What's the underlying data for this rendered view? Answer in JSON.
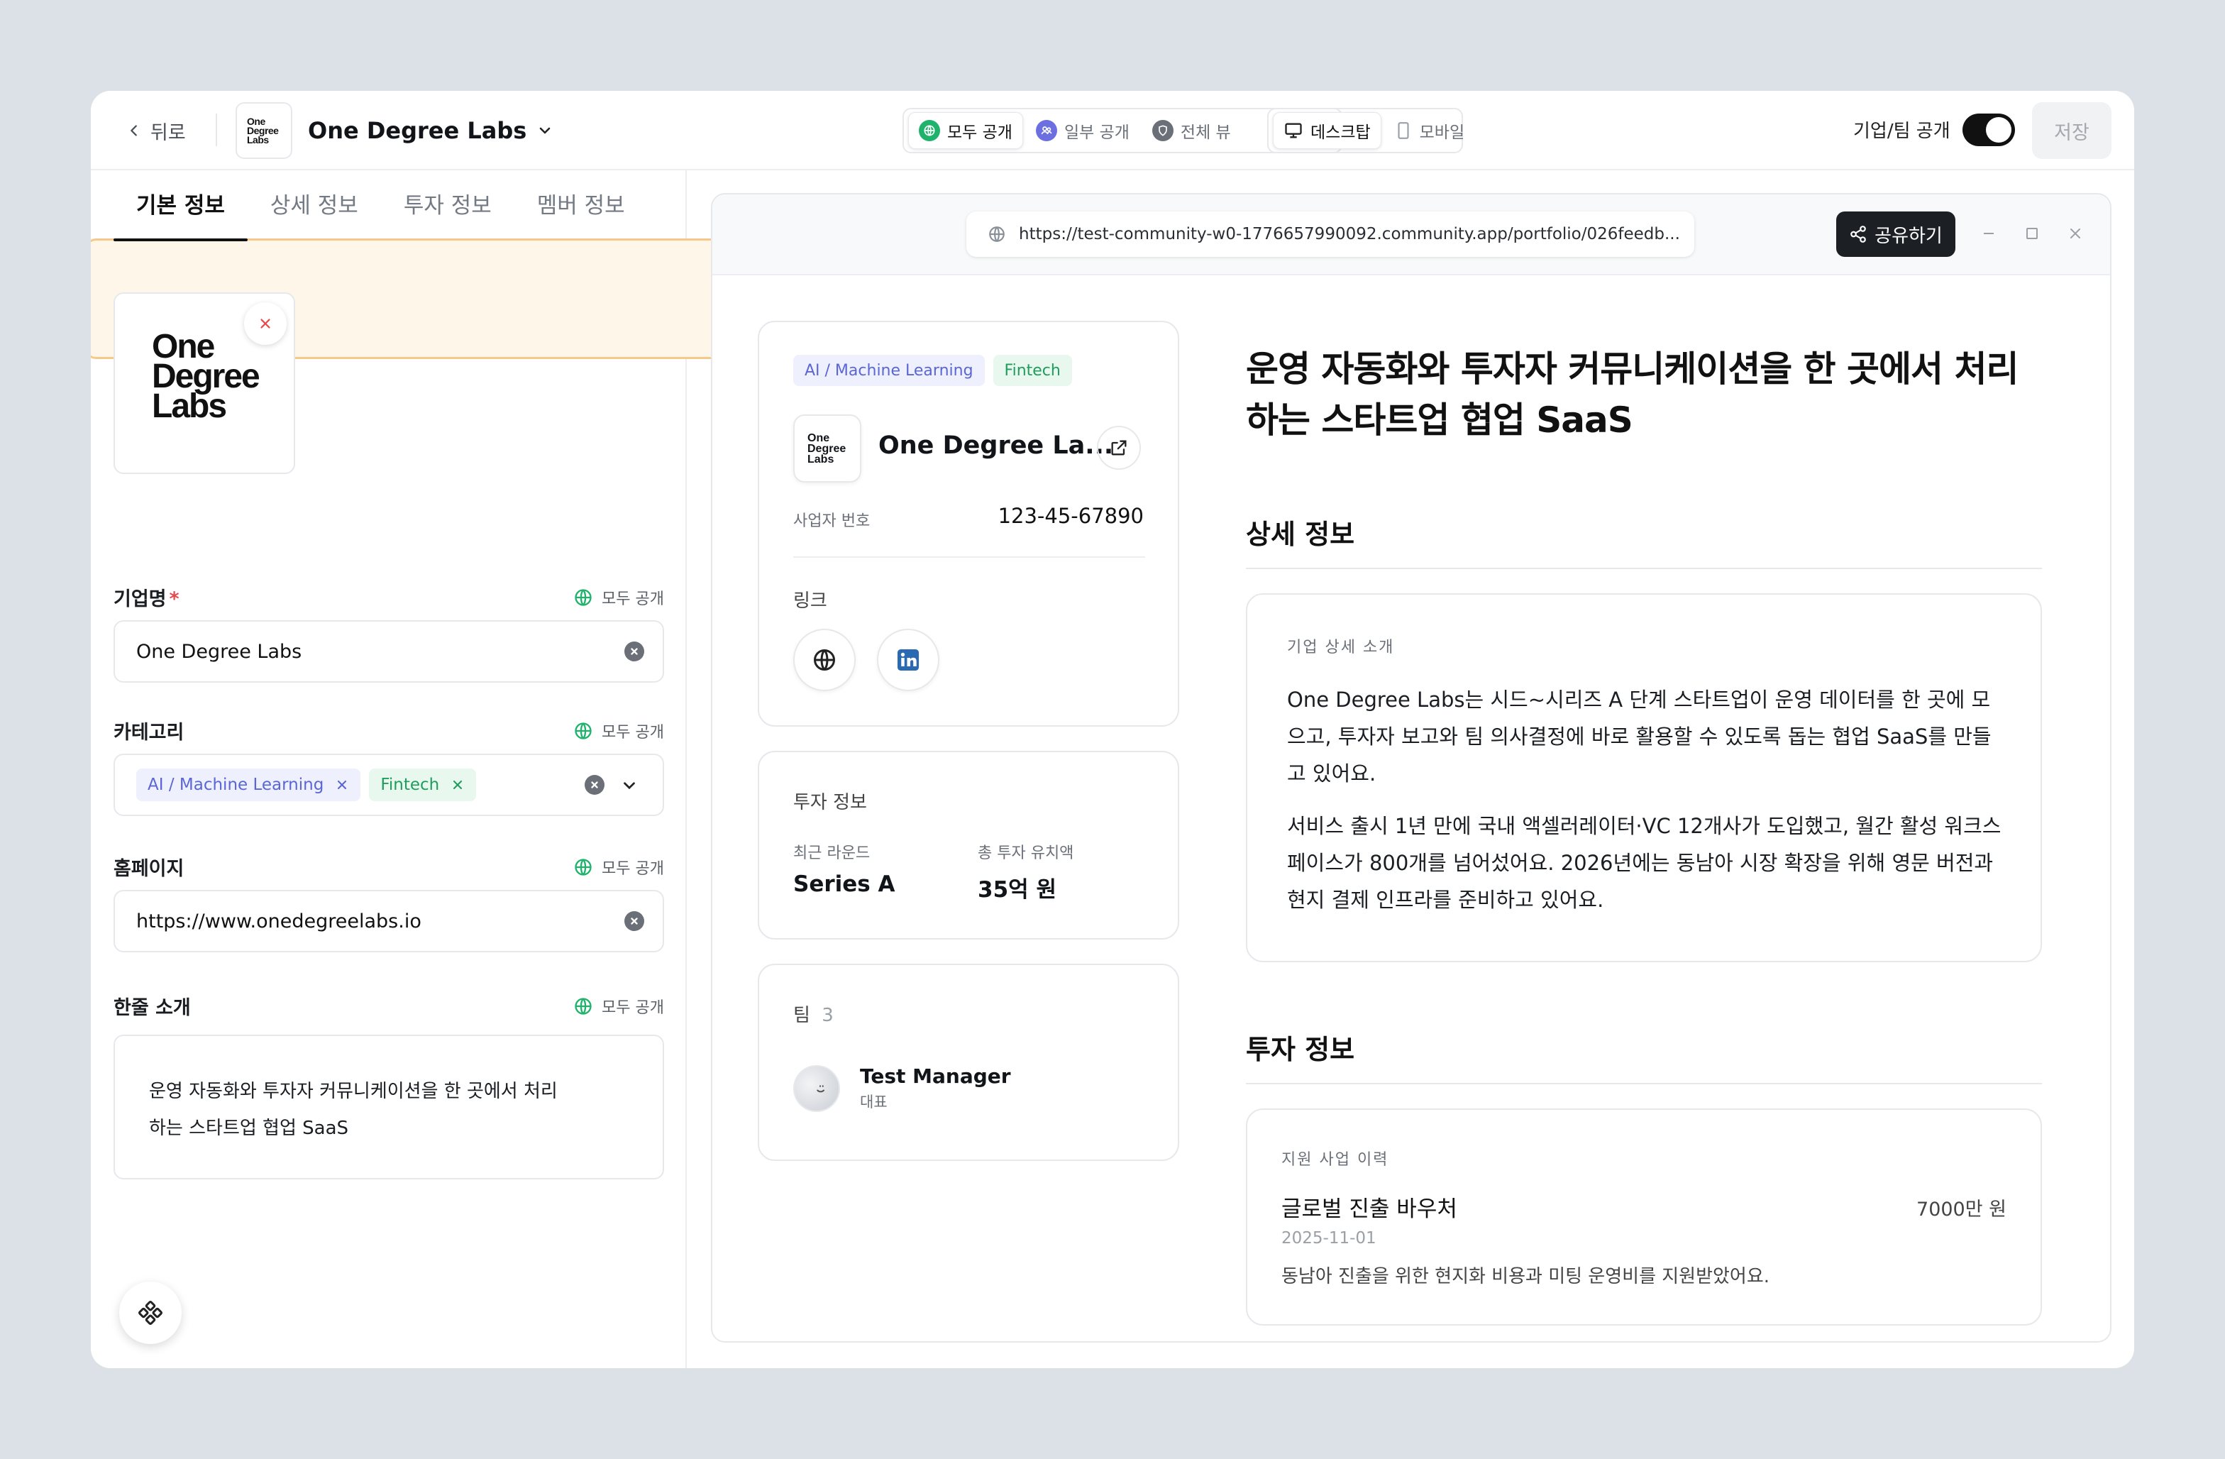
{
  "topbar": {
    "back_label": "뒤로",
    "logo_lines": [
      "One",
      "Degree",
      "Labs"
    ],
    "company_name": "One Degree Labs",
    "visibility_options": [
      {
        "label": "모두 공개",
        "color": "#1fb26b",
        "active": true
      },
      {
        "label": "일부 공개",
        "color": "#6b6fe0",
        "active": false
      },
      {
        "label": "전체 뷰",
        "color": "#6b7078",
        "active": false
      }
    ],
    "device_options": [
      {
        "label": "데스크탑",
        "active": true
      },
      {
        "label": "모바일",
        "active": false
      }
    ],
    "public_toggle_label": "기업/팀 공개",
    "public_toggle_on": true,
    "save_label": "저장"
  },
  "left_panel": {
    "tabs": [
      {
        "label": "기본 정보",
        "active": true
      },
      {
        "label": "상세 정보",
        "active": false
      },
      {
        "label": "투자 정보",
        "active": false
      },
      {
        "label": "멤버 정보",
        "active": false
      }
    ],
    "logo_lines": [
      "One",
      "Degree",
      "Labs"
    ],
    "visibility_label": "모두 공개",
    "fields": {
      "company_name": {
        "label": "기업명",
        "required_mark": "*",
        "value": "One Degree Labs"
      },
      "category": {
        "label": "카테고리",
        "chips": [
          "AI / Machine Learning",
          "Fintech"
        ]
      },
      "homepage": {
        "label": "홈페이지",
        "value": "https://www.onedegreelabs.io"
      },
      "tagline": {
        "label": "한줄 소개",
        "lines": [
          "운영 자동화와 투자자 커뮤니케이션을 한 곳에서 처리",
          "하는 스타트업 협업 SaaS"
        ]
      }
    }
  },
  "preview": {
    "url": "https://test-community-w0-1776657990092.community.app/portfolio/026feedb...",
    "share_label": "공유하기",
    "profile_card": {
      "tags": [
        "AI / Machine Learning",
        "Fintech"
      ],
      "name": "One Degree La...",
      "biz_label": "사업자 번호",
      "biz_number": "123-45-67890",
      "links_label": "링크"
    },
    "invest_card": {
      "title": "투자 정보",
      "round_label": "최근 라운드",
      "round_value": "Series A",
      "total_label": "총 투자 유치액",
      "total_value": "35억 원"
    },
    "team_card": {
      "title": "팀",
      "count": "3",
      "member_name": "Test Manager",
      "member_role": "대표"
    },
    "headline_lines": [
      "운영 자동화와 투자자 커뮤니케이션을 한 곳에서 처리",
      "하는 스타트업 협업 SaaS"
    ],
    "detail": {
      "section_title": "상세 정보",
      "box_label": "기업 상세 소개",
      "paragraph1": "One Degree Labs는 시드~시리즈 A 단계 스타트업이 운영 데이터를 한 곳에 모으고, 투자자 보고와 팀 의사결정에 바로 활용할 수 있도록 돕는 협업 SaaS를 만들고 있어요.",
      "paragraph2": "서비스 출시 1년 만에 국내 액셀러레이터·VC 12개사가 도입했고, 월간 활성 워크스페이스가 800개를 넘어섰어요. 2026년에는 동남아 시장 확장을 위해 영문 버전과 현지 결제 인프라를 준비하고 있어요."
    },
    "investment": {
      "section_title": "투자 정보",
      "box_label": "지원 사업 이력",
      "program_name": "글로벌 진출 바우처",
      "program_amount": "7000만 원",
      "program_date": "2025-11-01",
      "program_desc": "동남아 진출을 위한 현지화 비용과 미팅 운영비를 지원받았어요."
    }
  }
}
